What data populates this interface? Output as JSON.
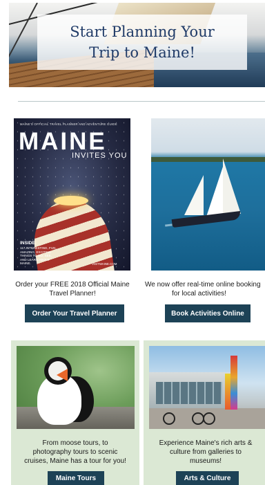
{
  "hero": {
    "title_line1": "Start Planning Your",
    "title_line2": "Trip to Maine!"
  },
  "cards": [
    {
      "image": {
        "kind": "magazine-cover",
        "kicker": "MAINE'S OFFICIAL TRAVEL PLANNER AND ADVENTURE GUIDE",
        "masthead": "MAINE",
        "subhead": "INVITES YOU",
        "inside_heading": "INSIDE:",
        "inside_text": "117 INTERESTING, FUN, AMAZING, EXCITING THINGS TO DO, SEE, AND LEARN ABOUT MAINE.",
        "url": "VISITMAINE.COM"
      },
      "text_line1": "Order your FREE 2018 Official Maine",
      "text_line2": "Travel Planner!",
      "button": "Order Your Travel Planner"
    },
    {
      "image": {
        "kind": "schooner-photo"
      },
      "text_line1": "We now offer real-time online booking",
      "text_line2": "for local activities!",
      "button": "Book Activities Online"
    },
    {
      "image": {
        "kind": "puffin-photo"
      },
      "text_line1": "From moose tours, to",
      "text_line2": "photography tours to scenic",
      "text_line3": "cruises, Maine has a tour for you!",
      "button": "Maine Tours"
    },
    {
      "image": {
        "kind": "museum-photo"
      },
      "text_line1": "Experience Maine's rich arts &",
      "text_line2": "culture from galleries to",
      "text_line3": "museums!",
      "button": "Arts & Culture"
    }
  ],
  "colors": {
    "title": "#1f3a67",
    "button_bg": "#1d4256",
    "panel_bg": "#dbe8d4",
    "divider": "#b9c7c9"
  }
}
